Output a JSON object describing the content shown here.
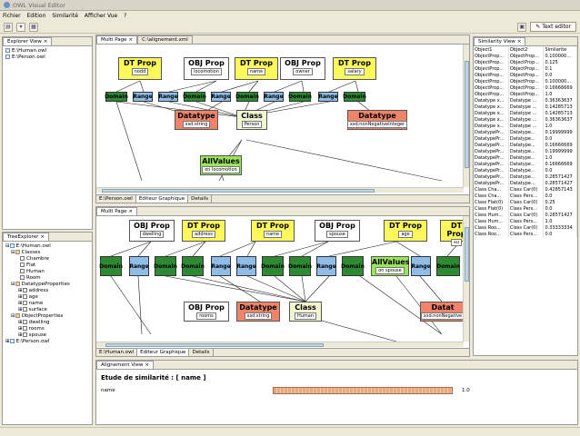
{
  "title": "OWL Visual Editor",
  "menu": [
    "Fichier",
    "Edition",
    "Similarité",
    "Afficher Vue",
    "?"
  ],
  "toolbar": {
    "text_editor": "Text editor"
  },
  "explorer": {
    "title": "Explorer View",
    "items": [
      "E:\\Human.owl",
      "E:\\Person.owl"
    ]
  },
  "tree": {
    "title": "TreeExplorer",
    "items": [
      "E:\\Human.owl",
      "Classes",
      "Chambre",
      "Flat",
      "Human",
      "Room",
      "DatatypeProperties",
      "address",
      "age",
      "name",
      "surface",
      "ObjectProperties",
      "dwelling",
      "rooms",
      "spouse",
      "E:\\Person.owl"
    ]
  },
  "top_editor": {
    "tabs": [
      "Multi Page",
      "C:\\alignement.xml"
    ],
    "bottom_tabs": [
      "E:\\Person.owl",
      "Editeur Graphique",
      "Details"
    ],
    "nodes": {
      "dt1": {
        "h": "DT Prop",
        "s": "nodd"
      },
      "obj1": {
        "h": "OBJ Prop",
        "s": "locomotion"
      },
      "dt2": {
        "h": "DT Prop",
        "s": "name"
      },
      "obj2": {
        "h": "OBJ Prop",
        "s": "owner"
      },
      "dt3": {
        "h": "DT Prop",
        "s": "salary"
      },
      "dtype1": {
        "h": "Datatype",
        "s": "xsd:string"
      },
      "class1": {
        "h": "Class",
        "s": "Person"
      },
      "dtype2": {
        "h": "Datatype",
        "s": "xsd:nonNegativeInteger"
      },
      "all1": {
        "h": "AllValues",
        "s": "on locomotion"
      }
    },
    "domain": "Domain",
    "range": "Range"
  },
  "bottom_editor": {
    "tabs": [
      "Multi Page"
    ],
    "bottom_tabs": [
      "E:\\Human.owl",
      "Editeur Graphique",
      "Details"
    ],
    "nodes": {
      "obj1": {
        "h": "OBJ Prop",
        "s": "dwelling"
      },
      "dt1": {
        "h": "DT Prop",
        "s": "address"
      },
      "dt2": {
        "h": "DT Prop",
        "s": "name"
      },
      "obj2": {
        "h": "OBJ Prop",
        "s": "spouse"
      },
      "dt3": {
        "h": "DT Prop",
        "s": "age"
      },
      "dt4": {
        "h": "DT Prop",
        "s": "su"
      },
      "all1": {
        "h": "AllValues",
        "s": "on spouse"
      },
      "obj3": {
        "h": "OBJ Prop",
        "s": "rooms"
      },
      "dtype1": {
        "h": "Datatype",
        "s": "xsd:string"
      },
      "class1": {
        "h": "Class",
        "s": "Human"
      },
      "dtype2": {
        "h": "Datat",
        "s": "xsd:nonNegative"
      }
    },
    "domain": "Domain",
    "range": "Range"
  },
  "similarity": {
    "title": "Similarity View",
    "columns": [
      "Object1",
      "Object2",
      "Similarite"
    ],
    "rows": [
      [
        "ObjectProp...",
        "ObjectProp...",
        "0.100000..."
      ],
      [
        "ObjectProp...",
        "ObjectProp...",
        "0.125"
      ],
      [
        "ObjectProp...",
        "ObjectProp...",
        "0.1"
      ],
      [
        "ObjectProp...",
        "ObjectProp...",
        "0.0"
      ],
      [
        "ObjectProp...",
        "ObjectProp...",
        "0.100000..."
      ],
      [
        "ObjectProp...",
        "ObjectProp...",
        "0.16666669"
      ],
      [
        "ObjectProp...",
        "ObjectProp...",
        "1.0"
      ],
      [
        "Datatype x...",
        "Datatype ...",
        "0.36363637"
      ],
      [
        "Datatype x...",
        "Datatype ...",
        "0.14285713"
      ],
      [
        "Datatype x...",
        "Datatype ...",
        "0.14285713"
      ],
      [
        "Datatype x...",
        "Datatype ...",
        "0.36363637"
      ],
      [
        "Datatype x...",
        "Datatype ...",
        "1.0"
      ],
      [
        "DatatypePr...",
        "Datatype...",
        "0.19999999"
      ],
      [
        "DatatypePr...",
        "Datatype...",
        "0.0"
      ],
      [
        "DatatypePr...",
        "Datatype...",
        "0.16666669"
      ],
      [
        "DatatypePr...",
        "Datatype...",
        "0.19999999"
      ],
      [
        "DatatypePr...",
        "Datatype...",
        "1.0"
      ],
      [
        "DatatypePr...",
        "Datatype...",
        "0.16666669"
      ],
      [
        "DatatypePr...",
        "Datatype...",
        "0.0"
      ],
      [
        "DatatypePr...",
        "Datatype...",
        "0.28571427"
      ],
      [
        "DatatypePr...",
        "Datatype...",
        "0.28571427"
      ],
      [
        "Class Cha...",
        "Class Car(0)",
        "0.42857143"
      ],
      [
        "Class Cha...",
        "Class Pers...",
        "0.0"
      ],
      [
        "Class Flat(0)",
        "Class Car(0)",
        "0.25"
      ],
      [
        "Class Flat(0)",
        "Class Pers...",
        "0.0"
      ],
      [
        "Class Hum...",
        "Class Car(0)",
        "0.28571427"
      ],
      [
        "Class Hum...",
        "Class Pers...",
        "1.0"
      ],
      [
        "Class Roo...",
        "Class Car(0)",
        "0.33333334"
      ],
      [
        "Class Roo...",
        "Class Pers...",
        "0.0"
      ]
    ]
  },
  "alignment": {
    "title": "Alignement View",
    "heading": "Etude de similarité : [ name ]",
    "label": "name",
    "value": "1.0",
    "score": 1.0
  },
  "colors": {
    "dt": "#faf85a",
    "domain": "#2e8a32",
    "range": "#8fbde8",
    "datatype": "#f0846a",
    "allvalues": "#9ae45a",
    "class": "#f2f6d0"
  }
}
